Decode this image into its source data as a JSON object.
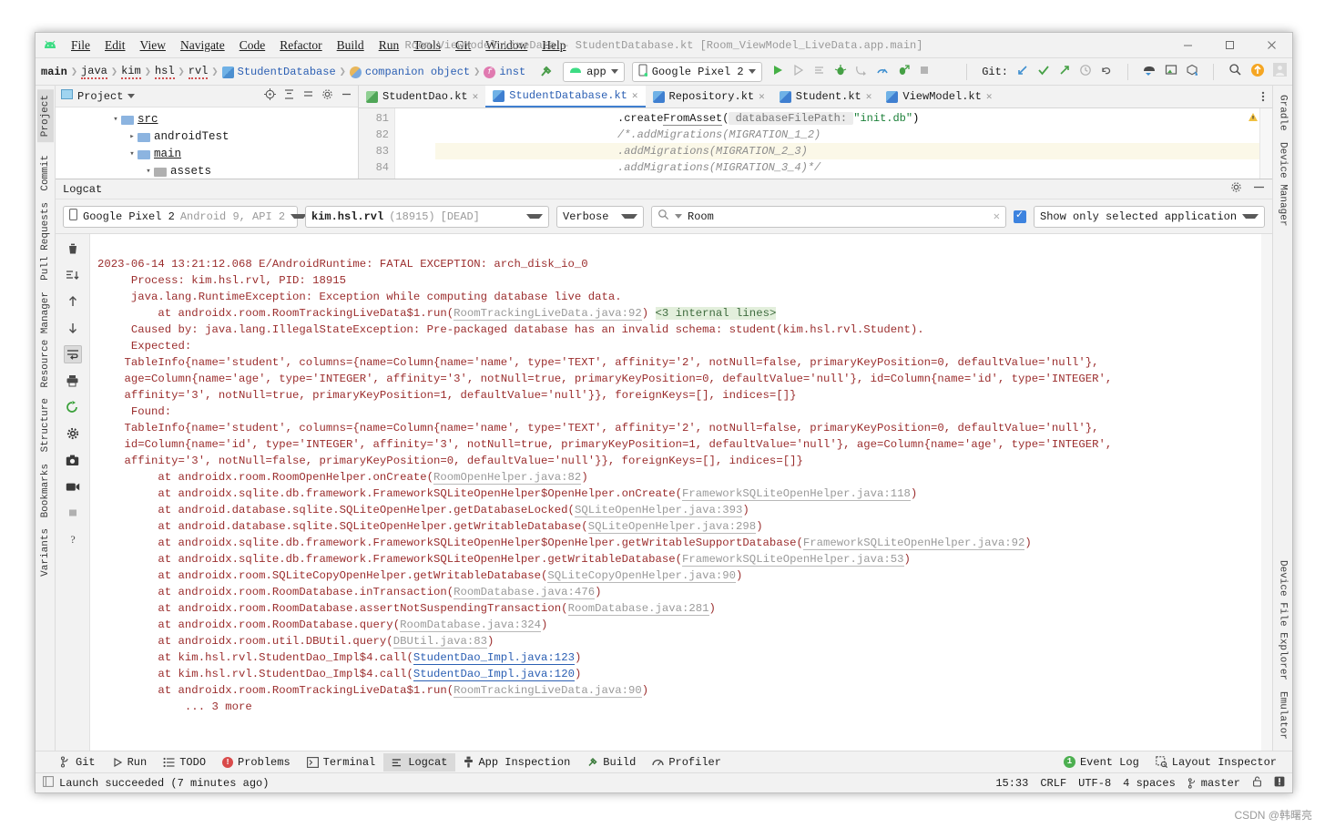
{
  "window": {
    "title": "Room_ViewModel_LiveData – StudentDatabase.kt [Room_ViewModel_LiveData.app.main]",
    "minimize": "–",
    "maximize": "☐",
    "close": "✕"
  },
  "menu": {
    "items": [
      "File",
      "Edit",
      "View",
      "Navigate",
      "Code",
      "Refactor",
      "Build",
      "Run",
      "Tools",
      "Git",
      "Window",
      "Help"
    ]
  },
  "navbar": {
    "breadcrumbs": [
      {
        "label": "main",
        "kind": "module"
      },
      {
        "label": "java",
        "kind": "dir"
      },
      {
        "label": "kim",
        "kind": "dir"
      },
      {
        "label": "hsl",
        "kind": "dir"
      },
      {
        "label": "rvl",
        "kind": "dir"
      },
      {
        "label": "StudentDatabase",
        "kind": "class"
      },
      {
        "label": "companion object",
        "kind": "object"
      },
      {
        "label": "inst",
        "kind": "function"
      }
    ],
    "run_config": "app",
    "device": "Google Pixel 2",
    "git_label": "Git:",
    "run_icons": [
      "run-icon",
      "rerun-icon",
      "apply-changes-icon",
      "debug-icon",
      "attach-debugger-icon",
      "profiler-icon",
      "debug-run-icon",
      "stop-icon"
    ],
    "git_icons": [
      "update-project-icon",
      "commit-icon",
      "push-icon",
      "history-icon",
      "rollback-icon"
    ],
    "extra_icons": [
      "device-manager-icon",
      "layout-icon",
      "sdk-icon",
      "search-icon",
      "update-icon",
      "avatar-icon"
    ]
  },
  "project_panel": {
    "title": "Project",
    "header_icons": [
      "target-icon",
      "expand-icon",
      "collapse-icon",
      "settings-icon",
      "hide-icon"
    ],
    "tree": [
      {
        "label": "src",
        "depth": 1,
        "twist": "▾",
        "underline": true
      },
      {
        "label": "androidTest",
        "depth": 2,
        "twist": "▸",
        "underline": false
      },
      {
        "label": "main",
        "depth": 2,
        "twist": "▾",
        "underline": true
      },
      {
        "label": "assets",
        "depth": 3,
        "twist": "▾",
        "underline": false
      }
    ]
  },
  "editor": {
    "tabs": [
      {
        "label": "StudentDao.kt",
        "active": false,
        "icon": "kotlin-file-icon"
      },
      {
        "label": "StudentDatabase.kt",
        "active": true,
        "icon": "kotlin-file-icon"
      },
      {
        "label": "Repository.kt",
        "active": false,
        "icon": "kotlin-file-icon"
      },
      {
        "label": "Student.kt",
        "active": false,
        "icon": "kotlin-file-icon"
      },
      {
        "label": "ViewModel.kt",
        "active": false,
        "icon": "kotlin-file-icon"
      }
    ],
    "line_numbers": [
      "81",
      "82",
      "83",
      "84"
    ],
    "lines": [
      {
        "n": "81",
        "seg": [
          {
            "t": ".createFromAsset(",
            "c": "plain"
          },
          {
            "t": " databaseFilePath: ",
            "c": "param"
          },
          {
            "t": "\"init.db\"",
            "c": "str"
          },
          {
            "t": ")",
            "c": "plain"
          }
        ],
        "highlight": false
      },
      {
        "n": "82",
        "seg": [
          {
            "t": "/*.addMigrations(MIGRATION_1_2)",
            "c": "cmt"
          }
        ],
        "highlight": false
      },
      {
        "n": "83",
        "seg": [
          {
            "t": ".addMigrations(MIGRATION_2_3)",
            "c": "cmt"
          }
        ],
        "highlight": true
      },
      {
        "n": "84",
        "seg": [
          {
            "t": ".addMigrations(MIGRATION_3_4)*/",
            "c": "cmt"
          }
        ],
        "highlight": false
      }
    ]
  },
  "logcat": {
    "title": "Logcat",
    "device_filter": {
      "name": "Google Pixel 2",
      "detail": "Android 9, API 2"
    },
    "process_filter": {
      "name": "kim.hsl.rvl",
      "pid": "(18915)",
      "state": "[DEAD]"
    },
    "level_filter": "Verbose",
    "search_value": "Room",
    "search_placeholder": "",
    "regex_checked": true,
    "scope_filter": "Show only selected application",
    "tool_icons": [
      "clear-all-icon",
      "scroll-to-end-icon",
      "up-icon",
      "down-icon",
      "soft-wrap-icon",
      "print-icon",
      "restart-icon",
      "settings-icon",
      "screenshot-icon",
      "screen-record-icon",
      "stop-icon",
      "help-icon"
    ],
    "output": [
      {
        "indent": 0,
        "parts": [
          {
            "t": "2023-06-14 13:21:12.068 E/AndroidRuntime: FATAL EXCEPTION: arch_disk_io_0",
            "k": "t"
          }
        ]
      },
      {
        "indent": 1,
        "parts": [
          {
            "t": "Process: kim.hsl.rvl, PID: 18915",
            "k": "t"
          }
        ]
      },
      {
        "indent": 1,
        "parts": [
          {
            "t": "java.lang.RuntimeException: Exception while computing database live data.",
            "k": "t"
          }
        ]
      },
      {
        "indent": 2,
        "parts": [
          {
            "t": "at androidx.room.RoomTrackingLiveData$1.run(",
            "k": "t"
          },
          {
            "t": "RoomTrackingLiveData.java:92",
            "k": "lnk"
          },
          {
            "t": ") ",
            "k": "t"
          },
          {
            "t": "<3 internal lines>",
            "k": "intl"
          }
        ]
      },
      {
        "indent": 1,
        "parts": [
          {
            "t": "Caused by: java.lang.IllegalStateException: Pre-packaged database has an invalid schema: student(kim.hsl.rvl.Student).",
            "k": "t"
          }
        ]
      },
      {
        "indent": 1,
        "parts": [
          {
            "t": "Expected:",
            "k": "t"
          }
        ]
      },
      {
        "indent": 1,
        "parts": [
          {
            "t": "TableInfo{name='student', columns={name=Column{name='name', type='TEXT', affinity='2', notNull=false, primaryKeyPosition=0, defaultValue='null'},",
            "k": "t"
          }
        ]
      },
      {
        "indent": 1,
        "parts": [
          {
            "t": " age=Column{name='age', type='INTEGER', affinity='3', notNull=true, primaryKeyPosition=0, defaultValue='null'}, id=Column{name='id', type='INTEGER',",
            "k": "t"
          }
        ]
      },
      {
        "indent": 1,
        "parts": [
          {
            "t": " affinity='3', notNull=true, primaryKeyPosition=1, defaultValue='null'}}, foreignKeys=[], indices=[]}",
            "k": "t"
          }
        ]
      },
      {
        "indent": 1,
        "parts": [
          {
            "t": "Found:",
            "k": "t"
          }
        ]
      },
      {
        "indent": 1,
        "parts": [
          {
            "t": "TableInfo{name='student', columns={name=Column{name='name', type='TEXT', affinity='2', notNull=false, primaryKeyPosition=0, defaultValue='null'},",
            "k": "t"
          }
        ]
      },
      {
        "indent": 1,
        "parts": [
          {
            "t": " id=Column{name='id', type='INTEGER', affinity='3', notNull=true, primaryKeyPosition=1, defaultValue='null'}, age=Column{name='age', type='INTEGER',",
            "k": "t"
          }
        ]
      },
      {
        "indent": 1,
        "parts": [
          {
            "t": " affinity='3', notNull=false, primaryKeyPosition=0, defaultValue='null'}}, foreignKeys=[], indices=[]}",
            "k": "t"
          }
        ]
      },
      {
        "indent": 2,
        "parts": [
          {
            "t": "at androidx.room.RoomOpenHelper.onCreate(",
            "k": "t"
          },
          {
            "t": "RoomOpenHelper.java:82",
            "k": "lnk"
          },
          {
            "t": ")",
            "k": "t"
          }
        ]
      },
      {
        "indent": 2,
        "parts": [
          {
            "t": "at androidx.sqlite.db.framework.FrameworkSQLiteOpenHelper$OpenHelper.onCreate(",
            "k": "t"
          },
          {
            "t": "FrameworkSQLiteOpenHelper.java:118",
            "k": "lnk"
          },
          {
            "t": ")",
            "k": "t"
          }
        ]
      },
      {
        "indent": 2,
        "parts": [
          {
            "t": "at android.database.sqlite.SQLiteOpenHelper.getDatabaseLocked(",
            "k": "t"
          },
          {
            "t": "SQLiteOpenHelper.java:393",
            "k": "lnk"
          },
          {
            "t": ")",
            "k": "t"
          }
        ]
      },
      {
        "indent": 2,
        "parts": [
          {
            "t": "at android.database.sqlite.SQLiteOpenHelper.getWritableDatabase(",
            "k": "t"
          },
          {
            "t": "SQLiteOpenHelper.java:298",
            "k": "lnk"
          },
          {
            "t": ")",
            "k": "t"
          }
        ]
      },
      {
        "indent": 2,
        "parts": [
          {
            "t": "at androidx.sqlite.db.framework.FrameworkSQLiteOpenHelper$OpenHelper.getWritableSupportDatabase(",
            "k": "t"
          },
          {
            "t": "FrameworkSQLiteOpenHelper.java:92",
            "k": "lnk"
          },
          {
            "t": ")",
            "k": "t"
          }
        ]
      },
      {
        "indent": 2,
        "parts": [
          {
            "t": "at androidx.sqlite.db.framework.FrameworkSQLiteOpenHelper.getWritableDatabase(",
            "k": "t"
          },
          {
            "t": "FrameworkSQLiteOpenHelper.java:53",
            "k": "lnk"
          },
          {
            "t": ")",
            "k": "t"
          }
        ]
      },
      {
        "indent": 2,
        "parts": [
          {
            "t": "at androidx.room.SQLiteCopyOpenHelper.getWritableDatabase(",
            "k": "t"
          },
          {
            "t": "SQLiteCopyOpenHelper.java:90",
            "k": "lnk"
          },
          {
            "t": ")",
            "k": "t"
          }
        ]
      },
      {
        "indent": 2,
        "parts": [
          {
            "t": "at androidx.room.RoomDatabase.inTransaction(",
            "k": "t"
          },
          {
            "t": "RoomDatabase.java:476",
            "k": "lnk"
          },
          {
            "t": ")",
            "k": "t"
          }
        ]
      },
      {
        "indent": 2,
        "parts": [
          {
            "t": "at androidx.room.RoomDatabase.assertNotSuspendingTransaction(",
            "k": "t"
          },
          {
            "t": "RoomDatabase.java:281",
            "k": "lnk"
          },
          {
            "t": ")",
            "k": "t"
          }
        ]
      },
      {
        "indent": 2,
        "parts": [
          {
            "t": "at androidx.room.RoomDatabase.query(",
            "k": "t"
          },
          {
            "t": "RoomDatabase.java:324",
            "k": "lnk"
          },
          {
            "t": ")",
            "k": "t"
          }
        ]
      },
      {
        "indent": 2,
        "parts": [
          {
            "t": "at androidx.room.util.DBUtil.query(",
            "k": "t"
          },
          {
            "t": "DBUtil.java:83",
            "k": "lnk"
          },
          {
            "t": ")",
            "k": "t"
          }
        ]
      },
      {
        "indent": 2,
        "parts": [
          {
            "t": "at kim.hsl.rvl.StudentDao_Impl$4.call(",
            "k": "t"
          },
          {
            "t": "StudentDao_Impl.java:123",
            "k": "lnkb"
          },
          {
            "t": ")",
            "k": "t"
          }
        ]
      },
      {
        "indent": 2,
        "parts": [
          {
            "t": "at kim.hsl.rvl.StudentDao_Impl$4.call(",
            "k": "t"
          },
          {
            "t": "StudentDao_Impl.java:120",
            "k": "lnkb"
          },
          {
            "t": ")",
            "k": "t"
          }
        ]
      },
      {
        "indent": 2,
        "parts": [
          {
            "t": "at androidx.room.RoomTrackingLiveData$1.run(",
            "k": "t"
          },
          {
            "t": "RoomTrackingLiveData.java:90",
            "k": "lnk"
          },
          {
            "t": ")",
            "k": "t"
          }
        ]
      },
      {
        "indent": 3,
        "parts": [
          {
            "t": "... 3 more",
            "k": "t"
          }
        ]
      }
    ]
  },
  "left_tool_window": {
    "items": [
      {
        "label": "Project",
        "icon": "project-icon",
        "active": true
      },
      {
        "label": "Commit",
        "icon": "commit-icon",
        "active": false
      },
      {
        "label": "Pull Requests",
        "icon": "pull-requests-icon",
        "active": false
      },
      {
        "label": "Resource Manager",
        "icon": "resource-manager-icon",
        "active": false
      },
      {
        "label": "Structure",
        "icon": "structure-icon",
        "active": false
      },
      {
        "label": "Bookmarks",
        "icon": "bookmarks-icon",
        "active": false
      },
      {
        "label": "Variants",
        "icon": "variants-icon",
        "active": false
      }
    ]
  },
  "right_tool_window": {
    "items": [
      {
        "label": "Gradle",
        "icon": "gradle-icon"
      },
      {
        "label": "Device Manager",
        "icon": "device-manager-icon"
      },
      {
        "label": "Device File Explorer",
        "icon": "device-file-explorer-icon"
      },
      {
        "label": "Emulator",
        "icon": "emulator-icon"
      }
    ]
  },
  "bottom_bar": {
    "items": [
      {
        "label": "Git",
        "icon": "git-branch-icon",
        "active": false
      },
      {
        "label": "Run",
        "icon": "run-icon",
        "active": false
      },
      {
        "label": "TODO",
        "icon": "todo-icon",
        "active": false
      },
      {
        "label": "Problems",
        "icon": "problems-icon",
        "active": false
      },
      {
        "label": "Terminal",
        "icon": "terminal-icon",
        "active": false
      },
      {
        "label": "Logcat",
        "icon": "logcat-icon",
        "active": true
      },
      {
        "label": "App Inspection",
        "icon": "app-inspection-icon",
        "active": false
      },
      {
        "label": "Build",
        "icon": "build-icon",
        "active": false
      },
      {
        "label": "Profiler",
        "icon": "profiler-icon",
        "active": false
      }
    ],
    "right_items": [
      {
        "label": "Event Log",
        "icon": "event-log-icon",
        "badge": "1"
      },
      {
        "label": "Layout Inspector",
        "icon": "layout-inspector-icon",
        "badge": ""
      }
    ]
  },
  "status_bar": {
    "message": "Launch succeeded (7 minutes ago)",
    "caret": "15:33",
    "line_sep": "CRLF",
    "encoding": "UTF-8",
    "indent": "4 spaces",
    "branch": "master",
    "icons": [
      "lock-icon",
      "notification-icon"
    ]
  },
  "watermark": "CSDN @韩曙亮"
}
